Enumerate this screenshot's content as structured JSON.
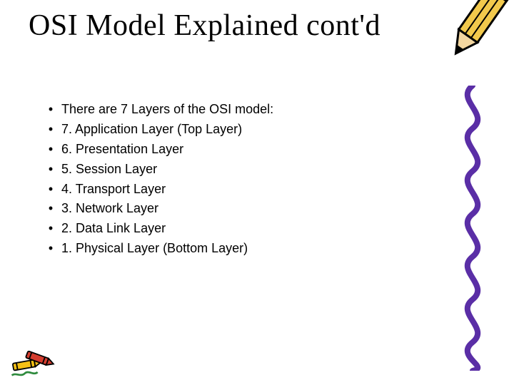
{
  "title": "OSI Model Explained cont'd",
  "bullets": [
    "There are 7 Layers of the OSI model:",
    "7. Application Layer (Top Layer)",
    "6. Presentation Layer",
    "5. Session Layer",
    "4. Transport Layer",
    "3. Network Layer",
    "2. Data Link Layer",
    "1. Physical Layer (Bottom Layer)"
  ]
}
